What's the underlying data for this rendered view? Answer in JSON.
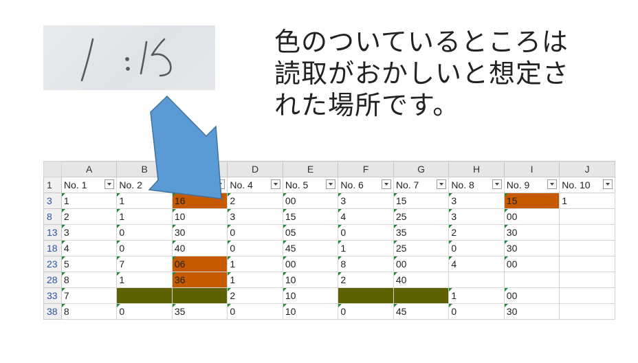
{
  "scan": {
    "text": "/ : 15"
  },
  "caption": {
    "lines": [
      "色のついているところは",
      "読取がおかしいと想定さ",
      "れた場所です。"
    ]
  },
  "spreadsheet": {
    "column_letters": [
      "A",
      "B",
      "C",
      "D",
      "E",
      "F",
      "G",
      "H",
      "I",
      "J"
    ],
    "header_row_number": "1",
    "headers": [
      "No. 1",
      "No. 2",
      "No. 3",
      "No. 4",
      "No. 5",
      "No. 6",
      "No. 7",
      "No. 8",
      "No. 9",
      "No. 10"
    ],
    "rows": [
      {
        "n": "3",
        "cells": [
          "1",
          "1",
          "16",
          "2",
          "00",
          "3",
          "15",
          "3",
          "15",
          "1"
        ]
      },
      {
        "n": "8",
        "cells": [
          "2",
          "1",
          "10",
          "3",
          "15",
          "4",
          "25",
          "3",
          "00",
          ""
        ]
      },
      {
        "n": "13",
        "cells": [
          "3",
          "0",
          "30",
          "0",
          "05",
          "0",
          "35",
          "2",
          "30",
          ""
        ]
      },
      {
        "n": "18",
        "cells": [
          "4",
          "0",
          "40",
          "0",
          "45",
          "1",
          "25",
          "0",
          "30",
          ""
        ]
      },
      {
        "n": "23",
        "cells": [
          "5",
          "7",
          "06",
          "1",
          "00",
          "8",
          "00",
          "4",
          "00",
          ""
        ]
      },
      {
        "n": "28",
        "cells": [
          "8",
          "1",
          "36",
          "1",
          "10",
          "2",
          "40",
          "",
          "",
          ""
        ]
      },
      {
        "n": "33",
        "cells": [
          "7",
          "",
          "",
          "2",
          "10",
          "",
          "",
          "1",
          "00",
          ""
        ]
      },
      {
        "n": "38",
        "cells": [
          "8",
          "0",
          "35",
          "0",
          "10",
          "0",
          "45",
          "0",
          "30",
          ""
        ]
      }
    ],
    "highlight_colors": {
      "orange": "#c55a00",
      "olive": "#5f6100"
    },
    "arrow_color": "#5b9bd5"
  }
}
